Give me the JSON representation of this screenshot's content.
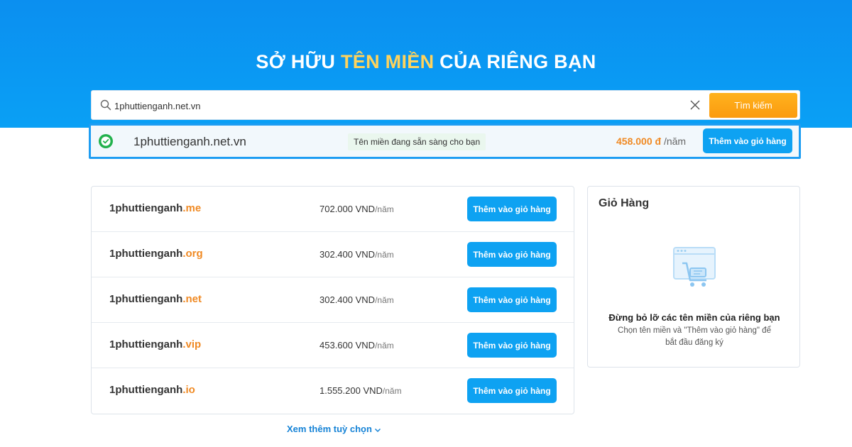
{
  "hero": {
    "title_before": "SỞ HỮU ",
    "title_highlight": "TÊN MIỀN",
    "title_after": " CỦA RIÊNG BẠN"
  },
  "search": {
    "value": "1phuttienganh.net.vn",
    "button_label": "Tìm kiếm"
  },
  "result": {
    "domain": "1phuttienganh.net.vn",
    "status": "Tên miền đang sẵn sàng cho bạn",
    "price": "458.000 đ",
    "unit": " /năm",
    "add_label": "Thêm vào giỏ hàng"
  },
  "domains": [
    {
      "base": "1phuttienganh",
      "tld": ".me",
      "price": "702.000 VND",
      "unit": "/năm",
      "add_label": "Thêm vào giỏ hàng"
    },
    {
      "base": "1phuttienganh",
      "tld": ".org",
      "price": "302.400 VND",
      "unit": "/năm",
      "add_label": "Thêm vào giỏ hàng"
    },
    {
      "base": "1phuttienganh",
      "tld": ".net",
      "price": "302.400 VND",
      "unit": "/năm",
      "add_label": "Thêm vào giỏ hàng"
    },
    {
      "base": "1phuttienganh",
      "tld": ".vip",
      "price": "453.600 VND",
      "unit": "/năm",
      "add_label": "Thêm vào giỏ hàng"
    },
    {
      "base": "1phuttienganh",
      "tld": ".io",
      "price": "1.555.200 VND",
      "unit": "/năm",
      "add_label": "Thêm vào giỏ hàng"
    }
  ],
  "more_label": "Xem thêm tuỳ chọn",
  "cart": {
    "title": "Giỏ Hàng",
    "empty_title": "Đừng bỏ lỡ các tên miền của riêng bạn",
    "empty_desc": "Chọn tên miền và \"Thêm vào giỏ hàng\" để bắt đầu đăng ký"
  },
  "colors": {
    "hero_blue": "#0b8ff0",
    "highlight_yellow": "#ffd35c",
    "accent_orange": "#f08a24",
    "button_blue": "#0ea2f2",
    "link_blue": "#1683d6",
    "success_green": "#22b14c"
  }
}
